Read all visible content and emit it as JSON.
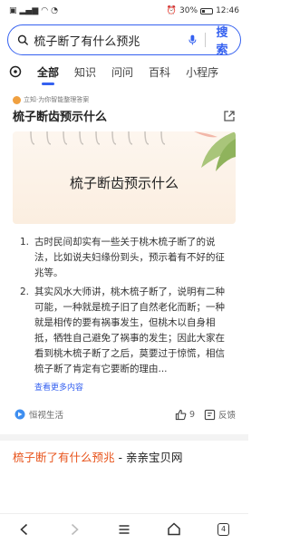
{
  "status_bar": {
    "left_icons": [
      "sim-icon",
      "signal-icon",
      "wifi-icon",
      "notification-icon"
    ],
    "battery_percent": "30%",
    "time": "12:46"
  },
  "search": {
    "query": "梳子断了有什么预兆",
    "button_label": "搜索"
  },
  "tabs": [
    {
      "label": "全部",
      "active": true
    },
    {
      "label": "知识"
    },
    {
      "label": "问问"
    },
    {
      "label": "百科"
    },
    {
      "label": "小程序"
    }
  ],
  "answer_card": {
    "ai_note": "立知·为你智能整理答案",
    "title": "梳子断齿预示什么",
    "hero_title": "梳子断齿预示什么",
    "items": [
      {
        "num": "1.",
        "text": "古时民间却实有一些关于桃木梳子断了的说法，比如说夫妇缘份到头，预示着有不好的征兆等。"
      },
      {
        "num": "2.",
        "text": "其实风水大师讲，桃木梳子断了，说明有二种可能，一种就是梳子旧了自然老化而断；一种就是相传的要有祸事发生，但桃木以自身相抵，牺牲自己避免了祸事的发生；因此大家在看到桃木梳子断了之后，莫要过于惊慌，相信梳子断了肯定有它要断的理由..."
      }
    ],
    "more_link": "查看更多内容",
    "source": "恒视生活",
    "like_count": "9",
    "feedback_label": "反馈"
  },
  "next_result": {
    "title_highlight": "梳子断了有什么预兆",
    "title_rest": " - 亲亲宝贝网"
  },
  "bottom_nav": {
    "tab_count": "4"
  }
}
